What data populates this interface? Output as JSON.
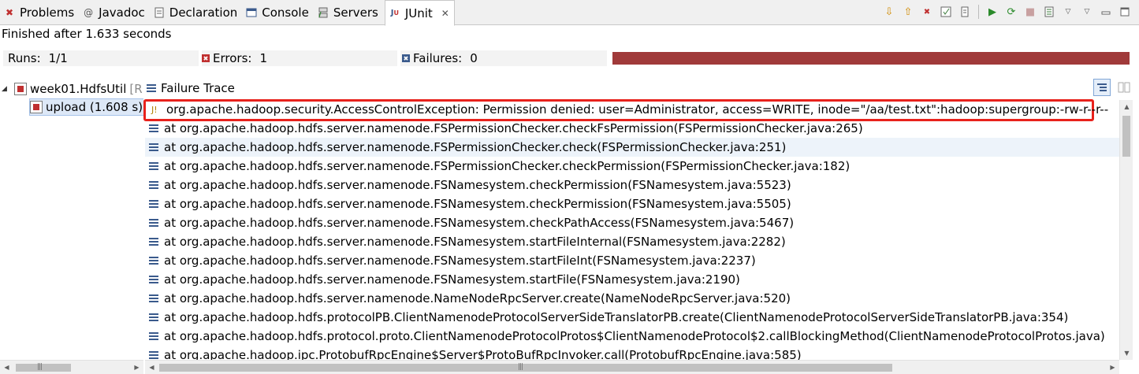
{
  "tabs": [
    {
      "label": "Problems",
      "icon": "problems-icon"
    },
    {
      "label": "Javadoc",
      "icon": "javadoc-icon"
    },
    {
      "label": "Declaration",
      "icon": "declaration-icon"
    },
    {
      "label": "Console",
      "icon": "console-icon"
    },
    {
      "label": "Servers",
      "icon": "servers-icon"
    },
    {
      "label": "JUnit",
      "icon": "junit-icon",
      "active": true
    }
  ],
  "status": {
    "finished": "Finished after 1.633 seconds"
  },
  "counters": {
    "runs_label": "Runs:",
    "runs_value": "1/1",
    "errors_label": "Errors:",
    "errors_value": "1",
    "failures_label": "Failures:",
    "failures_value": "0"
  },
  "progress": {
    "fraction": 1.0,
    "color": "#a03a3a"
  },
  "tree": {
    "suite_label": "week01.HdfsUtil",
    "suite_suffix": "[R",
    "test_label": "upload (1.608 s)"
  },
  "trace": {
    "header": "Failure Trace",
    "lines": [
      "org.apache.hadoop.security.AccessControlException: Permission denied: user=Administrator, access=WRITE, inode=\"/aa/test.txt\":hadoop:supergroup:-rw-r--r--",
      "at org.apache.hadoop.hdfs.server.namenode.FSPermissionChecker.checkFsPermission(FSPermissionChecker.java:265)",
      "at org.apache.hadoop.hdfs.server.namenode.FSPermissionChecker.check(FSPermissionChecker.java:251)",
      "at org.apache.hadoop.hdfs.server.namenode.FSPermissionChecker.checkPermission(FSPermissionChecker.java:182)",
      "at org.apache.hadoop.hdfs.server.namenode.FSNamesystem.checkPermission(FSNamesystem.java:5523)",
      "at org.apache.hadoop.hdfs.server.namenode.FSNamesystem.checkPermission(FSNamesystem.java:5505)",
      "at org.apache.hadoop.hdfs.server.namenode.FSNamesystem.checkPathAccess(FSNamesystem.java:5467)",
      "at org.apache.hadoop.hdfs.server.namenode.FSNamesystem.startFileInternal(FSNamesystem.java:2282)",
      "at org.apache.hadoop.hdfs.server.namenode.FSNamesystem.startFileInt(FSNamesystem.java:2237)",
      "at org.apache.hadoop.hdfs.server.namenode.FSNamesystem.startFile(FSNamesystem.java:2190)",
      "at org.apache.hadoop.hdfs.server.namenode.NameNodeRpcServer.create(NameNodeRpcServer.java:520)",
      "at org.apache.hadoop.hdfs.protocolPB.ClientNamenodeProtocolServerSideTranslatorPB.create(ClientNamenodeProtocolServerSideTranslatorPB.java:354)",
      "at org.apache.hadoop.hdfs.protocol.proto.ClientNamenodeProtocolProtos$ClientNamenodeProtocol$2.callBlockingMethod(ClientNamenodeProtocolProtos.java)",
      "at org.apache.hadoop.ipc.ProtobufRpcEngine$Server$ProtoBufRpcInvoker.call(ProtobufRpcEngine.java:585)"
    ]
  }
}
